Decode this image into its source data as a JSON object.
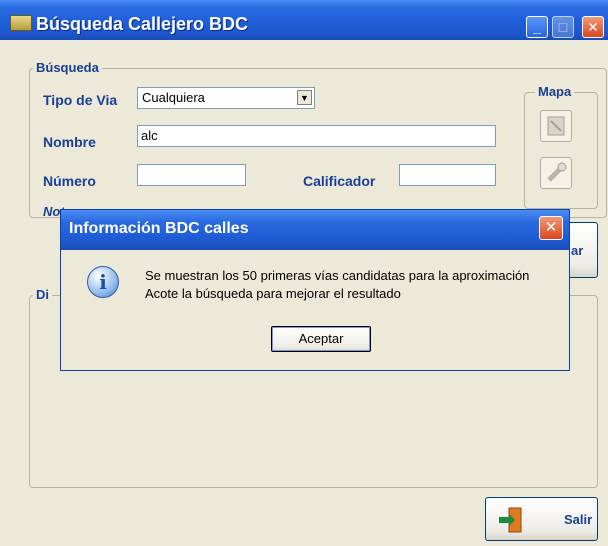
{
  "window": {
    "title": "Búsqueda Callejero BDC",
    "controls": {
      "minimize": "_",
      "maximize": "□",
      "close": "✕"
    }
  },
  "search": {
    "legend": "Búsqueda",
    "tipo_via_label": "Tipo de Via",
    "tipo_via_value": "Cualquiera",
    "nombre_label": "Nombre",
    "nombre_value": "alc",
    "numero_label": "Número",
    "numero_value": "",
    "calificador_label": "Calificador",
    "calificador_value": "",
    "note_fragment": "Not"
  },
  "map": {
    "legend": "Mapa"
  },
  "search_button": {
    "label_fragment": "ar"
  },
  "directions": {
    "legend_fragment": "Di"
  },
  "exit_button": {
    "label": "Salir"
  },
  "dialog": {
    "title": "Información BDC calles",
    "message_line1": "Se muestran los 50 primeras vías candidatas para la aproximación",
    "message_line2": "Acote la búsqueda para mejorar el resultado",
    "ok_label": "Aceptar",
    "close": "✕",
    "icon_glyph": "i"
  },
  "colors": {
    "accent": "#1f5ed8",
    "label": "#1a3f94",
    "face": "#ece9d8"
  }
}
